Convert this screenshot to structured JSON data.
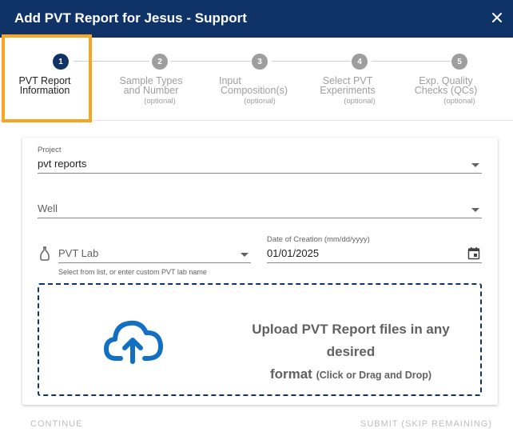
{
  "dialog": {
    "title": "Add PVT Report for Jesus - Support",
    "close_icon": "close-icon"
  },
  "stepper": {
    "steps": [
      {
        "number": "1",
        "label_line1": "PVT Report",
        "label_line2": "Information",
        "optional": "",
        "active": true
      },
      {
        "number": "2",
        "label_line1": "Sample Types",
        "label_line2": "and Number",
        "optional": "(optional)",
        "active": false
      },
      {
        "number": "3",
        "label_line1": "Input",
        "label_line2": "Composition(s)",
        "optional": "(optional)",
        "active": false
      },
      {
        "number": "4",
        "label_line1": "Select PVT",
        "label_line2": "Experiments",
        "optional": "(optional)",
        "active": false
      },
      {
        "number": "5",
        "label_line1": "Exp. Quality",
        "label_line2": "Checks (QCs)",
        "optional": "(optional)",
        "active": false
      }
    ]
  },
  "form": {
    "project": {
      "label": "Project",
      "value": "pvt reports"
    },
    "well": {
      "placeholder": "Well"
    },
    "pvt_lab": {
      "placeholder": "PVT Lab",
      "helper": "Select from list, or enter custom PVT lab name",
      "icon": "flask-icon"
    },
    "date_of_creation": {
      "label": "Date of Creation (mm/dd/yyyy)",
      "value": "01/01/2025",
      "icon": "calendar-icon"
    }
  },
  "upload": {
    "icon": "cloud-upload-icon",
    "text_line1": "Upload PVT Report files in any desired",
    "text_line2": "format",
    "hint": "(Click or Drag and Drop)"
  },
  "footer": {
    "continue_label": "CONTINUE",
    "submit_label": "SUBMIT (SKIP REMAINING)"
  },
  "colors": {
    "header_bg": "#0f3366",
    "active_step": "#0f3366",
    "inactive_step": "#9e9e9e",
    "highlight_box": "#f6a623",
    "dropzone_border": "#0f3366",
    "upload_icon": "#1270c4"
  }
}
